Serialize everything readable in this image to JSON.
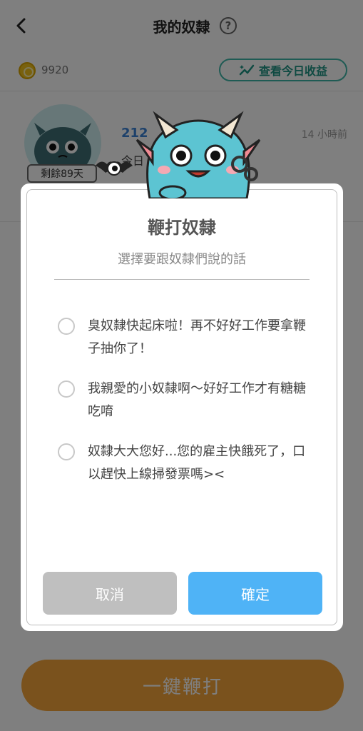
{
  "header": {
    "title": "我的奴隸",
    "back_icon": "chevron-left-icon",
    "help_icon": "question-circle-icon",
    "help_glyph": "?"
  },
  "subbar": {
    "coin_count": "9920",
    "coin_icon": "coin-icon",
    "earnings_label": "查看今日收益",
    "earnings_icon": "sparkle-chart-icon"
  },
  "slave_card": {
    "remaining_badge": "剩餘89天",
    "id_partial": "212",
    "time": "14 小時前",
    "message_partial": "今日"
  },
  "dialog": {
    "title": "鞭打奴隸",
    "subtitle": "選擇要跟奴隸們說的話",
    "options": [
      {
        "text": "臭奴隸快起床啦！再不好好工作要拿鞭子抽你了！",
        "selected": false
      },
      {
        "text": "我親愛的小奴隸啊～好好工作才有糖糖吃唷",
        "selected": false
      },
      {
        "text": "奴隸大大您好...您的雇主快餓死了，口以趕快上線掃發票嗎><",
        "selected": false
      }
    ],
    "cancel_label": "取消",
    "confirm_label": "確定"
  },
  "footer": {
    "whip_all_label": "一鍵鞭打"
  },
  "colors": {
    "accent_teal": "#3fb6a8",
    "confirm_blue": "#4fb3f6",
    "cancel_gray": "#bfbfbf",
    "whip_orange": "#f5a43a",
    "link_blue": "#3b82d6"
  }
}
